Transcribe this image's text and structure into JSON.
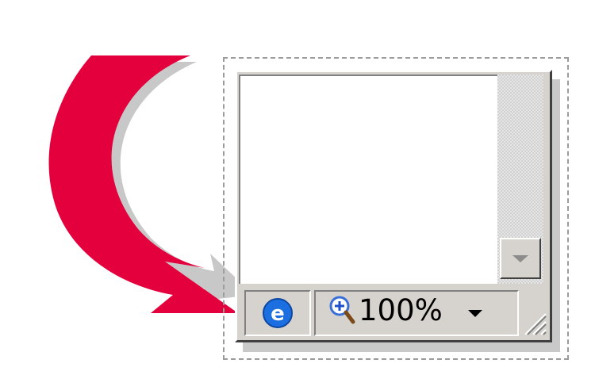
{
  "status_bar": {
    "zone_icon": "internet-explorer-icon",
    "zoom_icon": "zoom-magnifier-icon",
    "zoom_level": "100%",
    "zoom_dropdown_icon": "chevron-down-icon",
    "resize_grip_icon": "resize-grip-icon"
  },
  "scrollbar": {
    "down_icon": "scroll-down-arrow-icon"
  },
  "colors": {
    "arrow": "#e4003c",
    "window_face": "#d6d3ce",
    "ie_blue": "#1c6fe0"
  }
}
